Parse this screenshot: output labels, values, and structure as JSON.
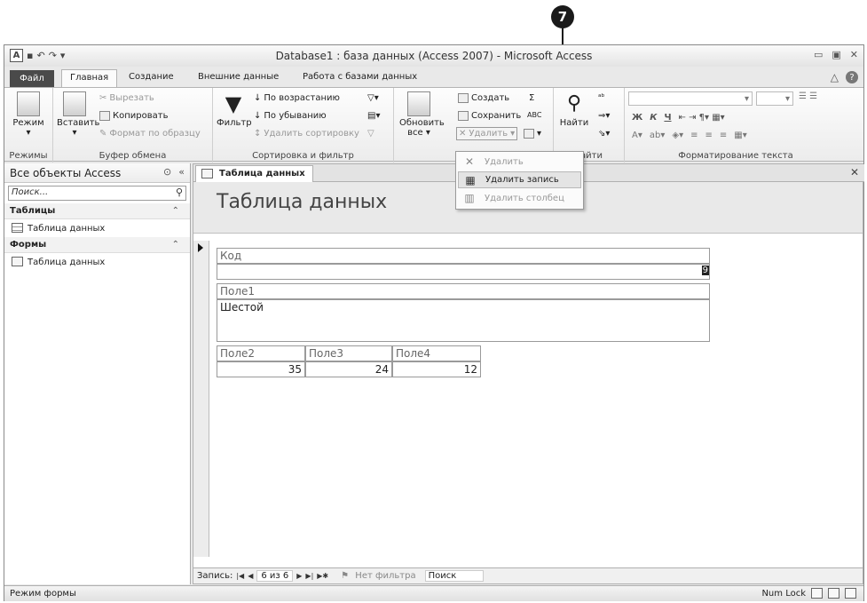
{
  "callout": {
    "number": "7"
  },
  "titlebar": {
    "title": "Database1 : база данных (Access 2007)  -  Microsoft Access",
    "logo": "A",
    "qat_icons": [
      "save-icon",
      "undo-icon",
      "redo-icon",
      "customize-icon"
    ],
    "window_controls": {
      "minimize": "▭",
      "restore": "▣",
      "close": "✕"
    }
  },
  "tabs": {
    "file": "Файл",
    "items": [
      "Главная",
      "Создание",
      "Внешние данные",
      "Работа с базами данных"
    ],
    "active": "Главная",
    "right": {
      "collapse": "△",
      "help": "?"
    }
  },
  "ribbon": {
    "groups": {
      "views": {
        "label": "Режимы",
        "button": "Режим"
      },
      "clipboard": {
        "label": "Буфер обмена",
        "paste": "Вставить",
        "cut": "Вырезать",
        "copy": "Копировать",
        "format_painter": "Формат по образцу"
      },
      "sort_filter": {
        "label": "Сортировка и фильтр",
        "filter": "Фильтр",
        "ascending": "По возрастанию",
        "descending": "По убыванию",
        "remove_sort": "Удалить сортировку"
      },
      "records": {
        "label": "Записи",
        "refresh_all": "Обновить",
        "refresh_all_sub": "все ▾",
        "new": "Создать",
        "save": "Сохранить",
        "delete": "Удалить",
        "totals": "Σ",
        "spelling": "ABC"
      },
      "find": {
        "label": "айти",
        "find": "Найти"
      },
      "text_format": {
        "label": "Форматирование текста",
        "bold": "Ж",
        "italic": "К",
        "underline": "Ч"
      }
    }
  },
  "delete_menu": {
    "items": [
      {
        "label": "Удалить",
        "icon": "delete-x-icon",
        "state": "disabled"
      },
      {
        "label": "Удалить запись",
        "icon": "delete-record-icon",
        "state": "hover"
      },
      {
        "label": "Удалить столбец",
        "icon": "delete-column-icon",
        "state": "disabled"
      }
    ]
  },
  "navpane": {
    "header": "Все объекты Access",
    "search_placeholder": "Поиск...",
    "groups": [
      {
        "title": "Таблицы",
        "items": [
          "Таблица данных"
        ]
      },
      {
        "title": "Формы",
        "items": [
          "Таблица данных"
        ]
      }
    ]
  },
  "document": {
    "tab_label": "Таблица данных",
    "form_title": "Таблица данных",
    "fields": {
      "kod": {
        "label": "Код",
        "value": "9"
      },
      "pole1": {
        "label": "Поле1",
        "value": "Шестой"
      },
      "pole2": {
        "label": "Поле2",
        "value": "35"
      },
      "pole3": {
        "label": "Поле3",
        "value": "24"
      },
      "pole4": {
        "label": "Поле4",
        "value": "12"
      }
    }
  },
  "recnav": {
    "label": "Запись:",
    "position": "6 из 6",
    "no_filter": "Нет фильтра",
    "search": "Поиск"
  },
  "statusbar": {
    "left": "Режим формы",
    "numlock": "Num Lock"
  }
}
